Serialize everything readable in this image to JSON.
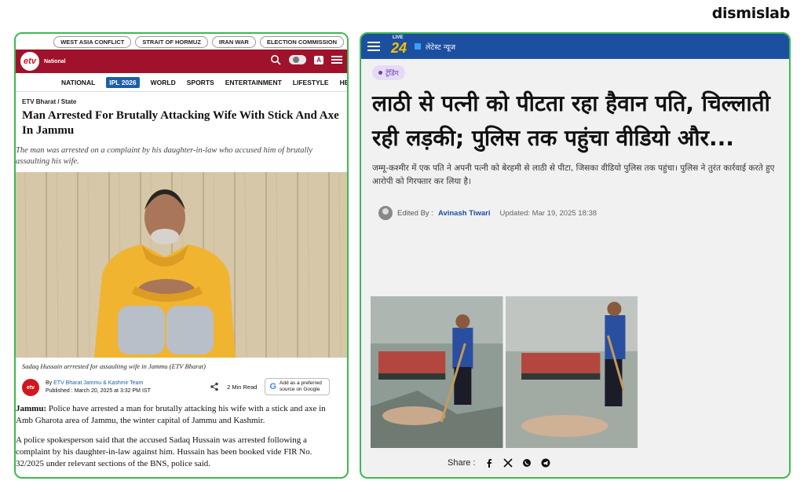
{
  "brand": "dismislab",
  "left": {
    "topic_pills": [
      "WEST ASIA CONFLICT",
      "STRAIT OF HORMUZ",
      "IRAN WAR",
      "ELECTION COMMISSION"
    ],
    "logo_text": "etv",
    "edition": "National",
    "lang_icon_text": "A",
    "nav": [
      "NATIONAL",
      "IPL 2026",
      "WORLD",
      "SPORTS",
      "ENTERTAINMENT",
      "LIFESTYLE",
      "HEALTH"
    ],
    "breadcrumb": "ETV Bharat / State",
    "title": "Man Arrested For Brutally Attacking Wife With Stick And Axe In Jammu",
    "subtitle": "The man was arrested on a complaint by his daughter-in-law who accused him of brutally assaulting his wife.",
    "photo_caption": "Sadaq Hussain arrrested for assaulting wife in Jammu (ETV Bharat)",
    "byline_prefix": "By",
    "byline_author": "ETV Bharat Jammu & Kashmir Team",
    "published": "Published : March 20, 2025 at 3:32 PM IST",
    "read_time": "2 Min Read",
    "google_badge": "Add as a preferred source on Google",
    "para1_lead": "Jammu:",
    "para1": " Police have arrested a man for brutally attacking his wife with a stick and axe in Amb Gharota area of Jammu, the winter capital of Jammu and Kashmir.",
    "para2": "A police spokesperson said that the accused Sadaq Hussain was arrested following a complaint by his daughter-in-law against him. Hussain has been booked vide FIR No. 32/2025 under relevant sections of the BNS, police said."
  },
  "right": {
    "logo_live": "LIVE",
    "logo_num": "24",
    "latest_news": "लेटेस्ट न्यूज",
    "trending": "ट्रेंडिंग",
    "title": "लाठी से पत्नी को पीटता रहा हैवान पति, चिल्लाती रही लड़की; पुलिस तक पहुंचा वीडियो और...",
    "summary": "जम्मू-कश्मीर में एक पति ने अपनी पत्नी को बेरहमी से लाठी से पीटा, जिसका वीडियो पुलिस तक पहुंचा। पुलिस ने तुरंत कार्रवाई करते हुए आरोपी को गिरफ्तार कर लिया है।",
    "edited_by_label": "Edited By :",
    "editor": "Avinash Tiwari",
    "updated": "Updated: Mar 19, 2025 18:38",
    "share_label": "Share :"
  },
  "colors": {
    "panel_border": "#3dba4f",
    "etv_red": "#a0122c",
    "news24_blue": "#1c4fa0",
    "trending_purple": "#6b3fb0"
  }
}
